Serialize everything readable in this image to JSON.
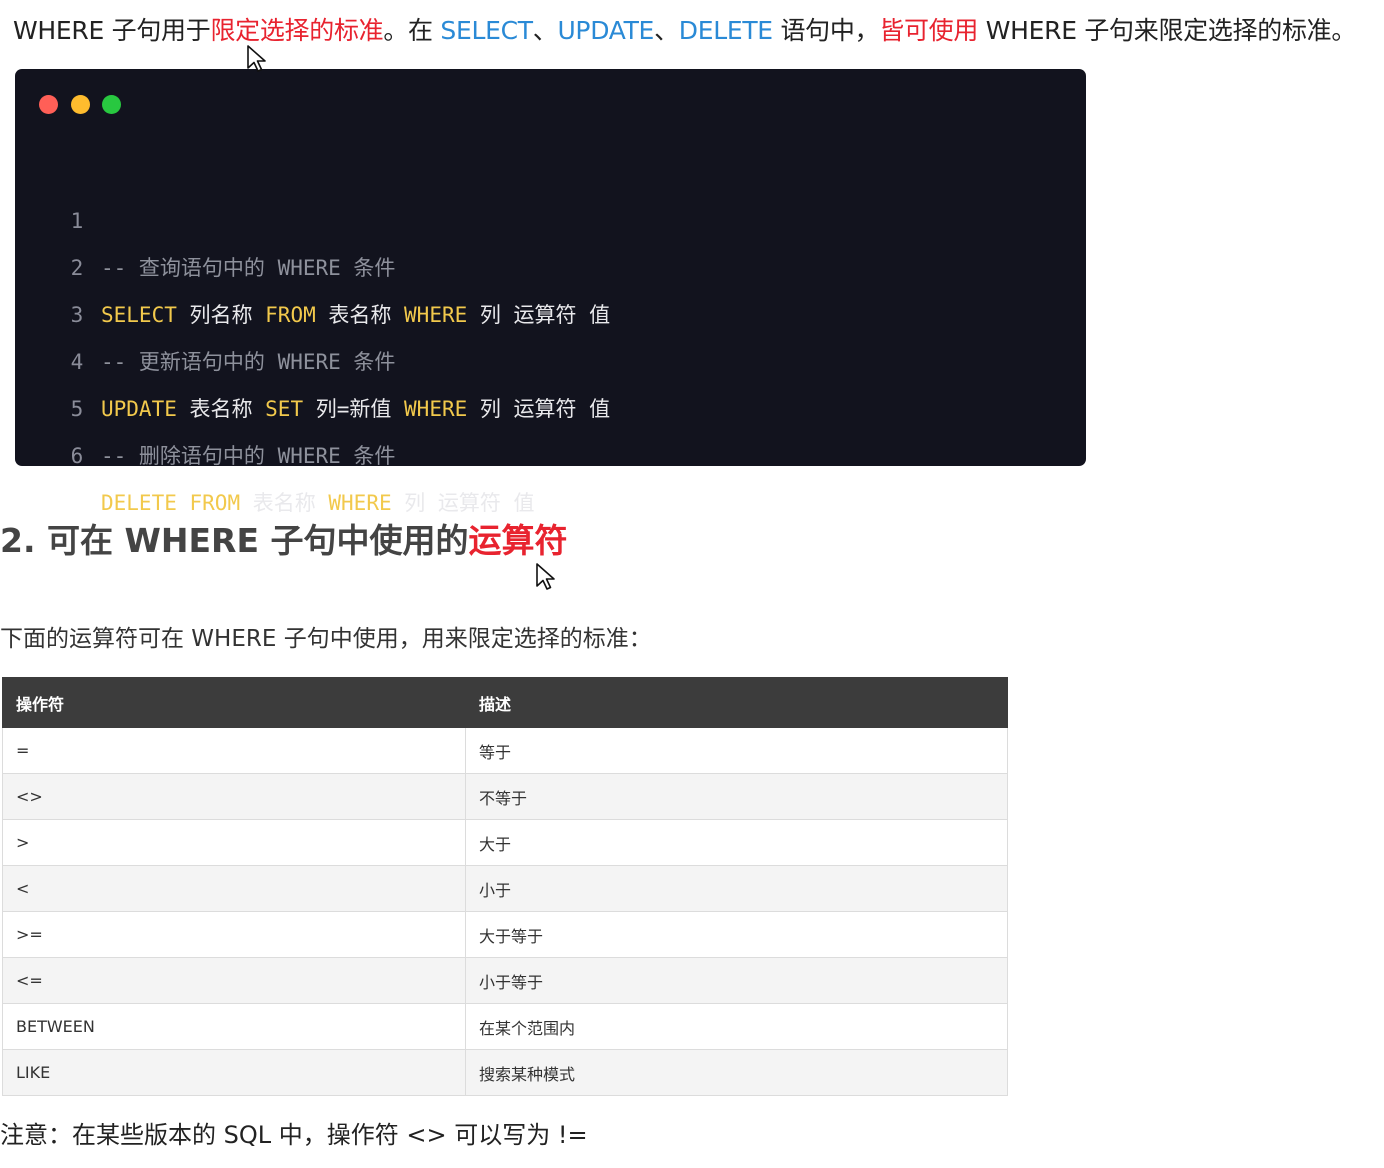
{
  "intro": {
    "p1": "WHERE 子句用于",
    "h1": "限定选择的标准",
    "p2": "。在 ",
    "k1": "SELECT",
    "sep1": "、",
    "k2": "UPDATE",
    "sep2": "、",
    "k3": "DELETE",
    "p3": " 语句中，",
    "h2": "皆可使用",
    "p4": " WHERE 子句来限定选择的标准。"
  },
  "code": {
    "window_dots": [
      "#ff5f57",
      "#febc2e",
      "#28c840"
    ],
    "lines": [
      {
        "n": "1",
        "comment": "-- 查询语句中的 WHERE 条件"
      },
      {
        "n": "2",
        "kw1": "SELECT",
        "t1": " 列名称 ",
        "kw2": "FROM",
        "t2": " 表名称 ",
        "kw3": "WHERE",
        "t3": " 列 运算符 值"
      },
      {
        "n": "3",
        "comment": "-- 更新语句中的 WHERE 条件"
      },
      {
        "n": "4",
        "kw1": "UPDATE",
        "t1": " 表名称 ",
        "kw2": "SET",
        "t2": " 列=新值 ",
        "kw3": "WHERE",
        "t3": " 列 运算符 值"
      },
      {
        "n": "5",
        "comment": "-- 删除语句中的 WHERE 条件"
      },
      {
        "n": "6",
        "kw1": "DELETE",
        "t1": " ",
        "kw2": "FROM",
        "t2": " 表名称 ",
        "kw3": "WHERE",
        "t3": " 列 运算符 值"
      }
    ]
  },
  "section": {
    "title_plain": "2. 可在 WHERE 子句中使用的",
    "title_red": "运算符"
  },
  "description": "下面的运算符可在 WHERE 子句中使用，用来限定选择的标准：",
  "table": {
    "headers": [
      "操作符",
      "描述"
    ],
    "rows": [
      [
        "=",
        "等于"
      ],
      [
        "<>",
        "不等于"
      ],
      [
        ">",
        "大于"
      ],
      [
        "<",
        "小于"
      ],
      [
        ">=",
        "大于等于"
      ],
      [
        "<=",
        "小于等于"
      ],
      [
        "BETWEEN",
        "在某个范围内"
      ],
      [
        "LIKE",
        "搜索某种模式"
      ]
    ]
  },
  "note": "注意：在某些版本的 SQL 中，操作符 <> 可以写为 !=",
  "colors": {
    "highlight_red": "#e8232f",
    "keyword_blue": "#2a8ad6",
    "code_bg": "#12131e",
    "code_keyword": "#f2c94c",
    "table_header_bg": "#3c3c3c"
  }
}
